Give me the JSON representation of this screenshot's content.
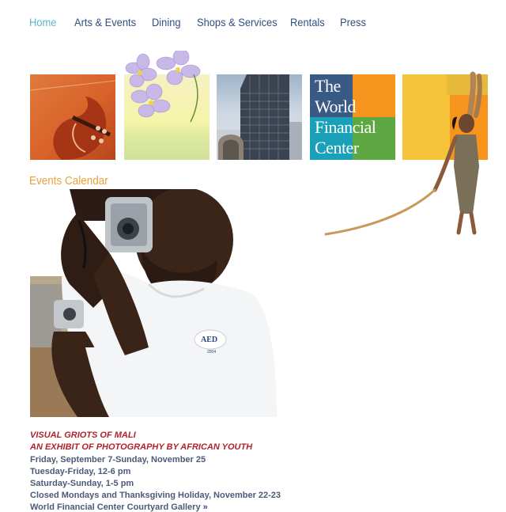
{
  "nav": {
    "items": [
      {
        "label": "Home",
        "active": true
      },
      {
        "label": "Arts & Events"
      },
      {
        "label": "Dining"
      },
      {
        "label": "Shops & Services"
      },
      {
        "label": "Rentals"
      },
      {
        "label": "Press"
      }
    ]
  },
  "banner": {
    "logo_lines": [
      "The",
      "World",
      "Financial",
      "Center"
    ]
  },
  "events": {
    "heading": "Events Calendar",
    "title_line1": "VISUAL GRIOTS OF MALI",
    "title_line2": "AN EXHIBIT OF PHOTOGRAPHY BY AFRICAN YOUTH",
    "dates": "Friday, September 7-Sunday, November 25",
    "hours_weekday": "Tuesday-Friday, 12-6 pm",
    "hours_weekend": "Saturday-Sunday, 1-5 pm",
    "closed": "Closed Mondays and Thanksgiving Holiday, November 22-23",
    "location": "World Financial Center Courtyard Gallery"
  },
  "photo": {
    "shirt_logo": "AED",
    "shirt_year": "2004"
  },
  "colors": {
    "nav_text": "#2e4f82",
    "nav_active": "#5ab4c9",
    "heading": "#e9a23b",
    "event_title": "#b1232a",
    "event_info": "#4b5a78"
  }
}
